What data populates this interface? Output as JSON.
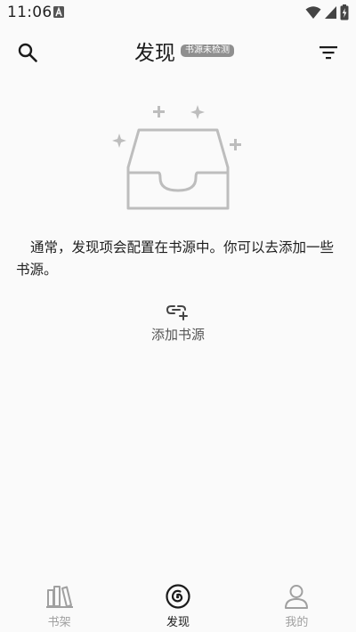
{
  "status_bar": {
    "time": "11:06",
    "notification_icon": "a-letter-icon",
    "icons": [
      "wifi-icon",
      "signal-icon",
      "battery-charging-icon"
    ]
  },
  "app_bar": {
    "title": "发现",
    "badge": "书源未检测",
    "search_icon": "search-icon",
    "filter_icon": "filter-icon"
  },
  "empty_state": {
    "illustration": "empty-inbox-icon",
    "message": "通常，发现项会配置在书源中。你可以去添加一些书源。",
    "action_icon": "link-add-icon",
    "action_label": "添加书源"
  },
  "bottom_nav": {
    "items": [
      {
        "label": "书架",
        "icon": "bookshelf-icon",
        "active": false
      },
      {
        "label": "发现",
        "icon": "discover-icon",
        "active": true
      },
      {
        "label": "我的",
        "icon": "profile-icon",
        "active": false
      }
    ]
  },
  "colors": {
    "background": "#fafafa",
    "badge": "#8f8f8f",
    "inactive": "#a0a0a0",
    "active": "#1b1b1b",
    "illustration": "#bdbdbd"
  }
}
